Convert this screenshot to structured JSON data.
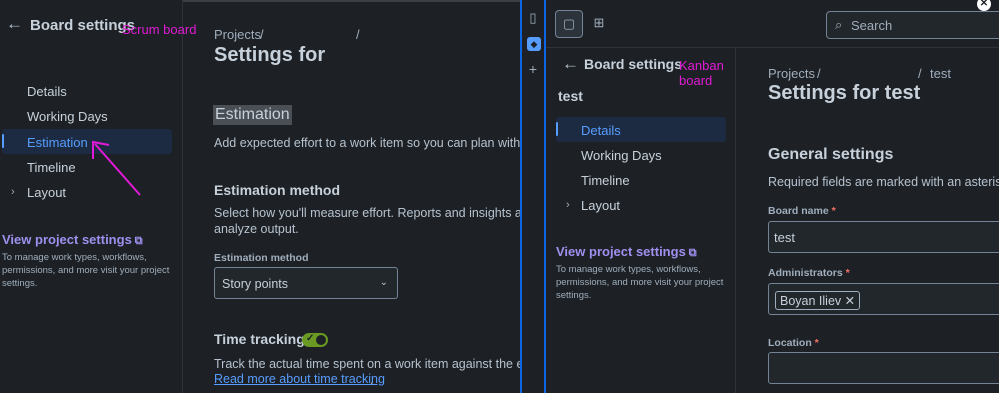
{
  "scrum": {
    "title": "Board settings",
    "annotation": "Scrum board",
    "nav": [
      {
        "label": "Details"
      },
      {
        "label": "Working Days"
      },
      {
        "label": "Estimation"
      },
      {
        "label": "Timeline"
      },
      {
        "label": "Layout"
      }
    ],
    "project_link": "View project settings",
    "project_note": "To manage work types, workflows, permissions, and more visit your project settings.",
    "breadcrumb_projects": "Projects",
    "breadcrumb_sep": "/",
    "page_title": "Settings for",
    "section_title": "Estimation",
    "section_desc": "Add expected effort to a work item so you can plan with more",
    "method_heading": "Estimation method",
    "method_desc_1": "Select how you'll measure effort. Reports and insights also use",
    "method_desc_2": "analyze output.",
    "method_field_label": "Estimation method",
    "method_value": "Story points",
    "time_tracking_heading": "Time tracking",
    "time_tracking_enabled": true,
    "time_tracking_desc": "Track the actual time spent on a work item against the estimate",
    "time_tracking_link": "Read more about time tracking",
    "time_tracking_link_suffix": "."
  },
  "kanban": {
    "search_placeholder": "Search",
    "title": "Board settings",
    "annotation": "Kanban board",
    "board_name_sidebar": "test",
    "nav": [
      {
        "label": "Details"
      },
      {
        "label": "Working Days"
      },
      {
        "label": "Timeline"
      },
      {
        "label": "Layout"
      }
    ],
    "project_link": "View project settings",
    "project_note": "To manage work types, workflows, permissions, and more visit your project settings.",
    "breadcrumb_projects": "Projects",
    "breadcrumb_sep": "/",
    "breadcrumb_board": "test",
    "page_title": "Settings for test",
    "section_title": "General settings",
    "required_note": "Required fields are marked with an asterisk",
    "board_name_label": "Board name",
    "board_name_value": "test",
    "administrators_label": "Administrators",
    "administrator_tag": "Boyan Iliev",
    "location_label": "Location",
    "required_mark": "*"
  },
  "colors": {
    "annotation": "#e01ad6",
    "accent": "#579dff",
    "link_purple": "#9f8fef",
    "toggle_on": "#6a9a23"
  }
}
